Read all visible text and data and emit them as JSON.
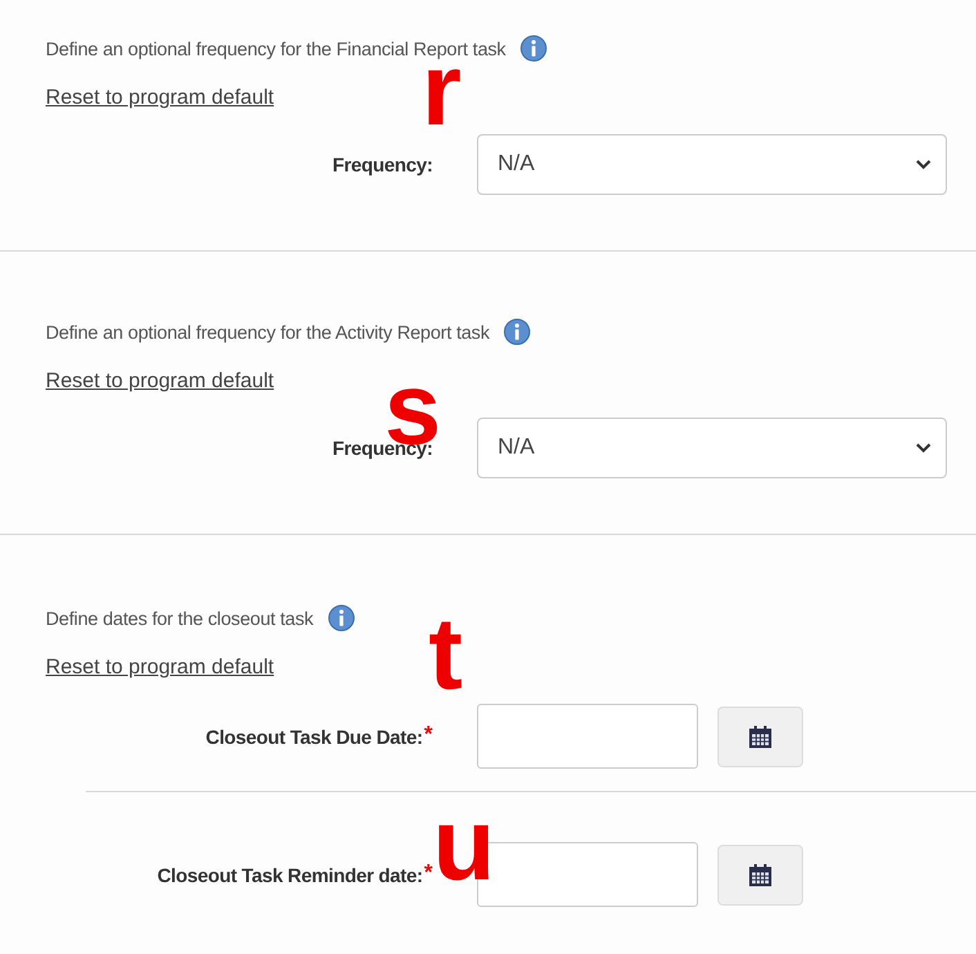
{
  "sections": [
    {
      "description": "Define an optional frequency for the Financial Report task",
      "reset_link": "Reset to program default",
      "marker": "r",
      "fields": [
        {
          "kind": "select",
          "label": "Frequency:",
          "value": "N/A"
        }
      ]
    },
    {
      "description": "Define an optional frequency for the Activity Report task",
      "reset_link": "Reset to program default",
      "marker": "s",
      "fields": [
        {
          "kind": "select",
          "label": "Frequency:",
          "value": "N/A"
        }
      ]
    },
    {
      "description": "Define dates for the closeout task",
      "reset_link": "Reset to program default",
      "marker": "t",
      "fields": [
        {
          "kind": "date",
          "label": "Closeout Task Due Date:",
          "required_mark": "*"
        },
        {
          "kind": "date",
          "label": "Closeout Task Reminder date:",
          "required_mark": "*",
          "marker": "u"
        }
      ]
    }
  ]
}
